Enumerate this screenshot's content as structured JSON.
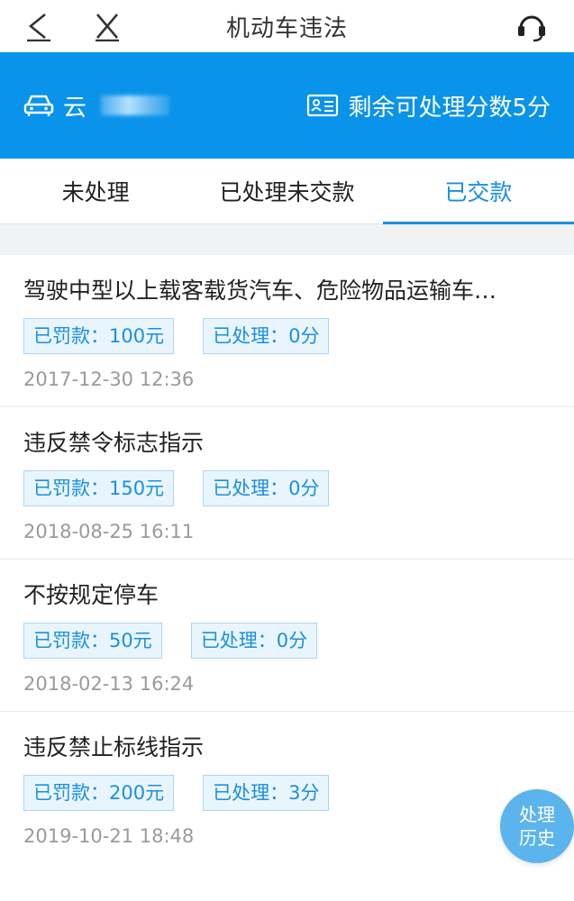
{
  "header": {
    "title": "机动车违法"
  },
  "banner": {
    "plate_prefix": "云",
    "points_text": "剩余可处理分数5分"
  },
  "tabs": [
    {
      "label": "未处理"
    },
    {
      "label": "已处理未交款"
    },
    {
      "label": "已交款"
    }
  ],
  "violations": [
    {
      "name": "驾驶中型以上载客载货汽车、危险物品运输车…",
      "fine": "已罚款：100元",
      "points": "已处理：0分",
      "time": "2017-12-30 12:36"
    },
    {
      "name": "违反禁令标志指示",
      "fine": "已罚款：150元",
      "points": "已处理：0分",
      "time": "2018-08-25 16:11"
    },
    {
      "name": "不按规定停车",
      "fine": "已罚款：50元",
      "points": "已处理：0分",
      "time": "2018-02-13 16:24"
    },
    {
      "name": "违反禁止标线指示",
      "fine": "已罚款：200元",
      "points": "已处理：3分",
      "time": "2019-10-21 18:48"
    }
  ],
  "history_button": {
    "line1": "处理",
    "line2": "历史"
  },
  "colors": {
    "brand_blue": "#0a93ea",
    "active_tab": "#1a8fe0",
    "history_button": "#5cb4ec"
  }
}
